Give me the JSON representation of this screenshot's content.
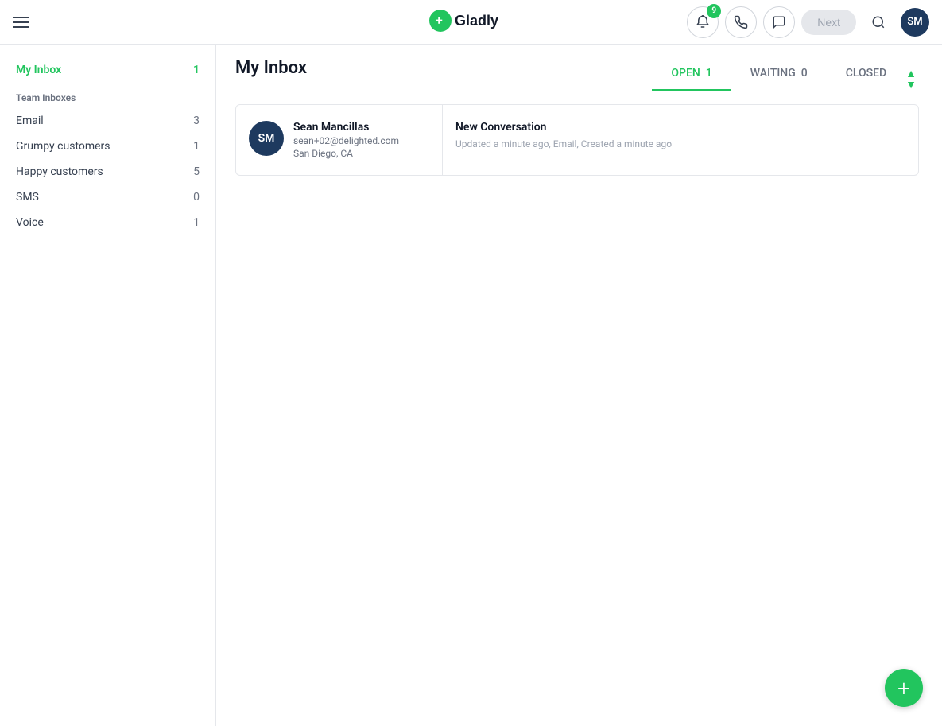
{
  "topnav": {
    "logo_text": "Gladly",
    "notification_badge": "9",
    "next_button_label": "Next",
    "avatar_initials": "SM"
  },
  "sidebar": {
    "my_inbox_label": "My Inbox",
    "my_inbox_count": "1",
    "team_inboxes_title": "Team Inboxes",
    "items": [
      {
        "label": "Email",
        "count": "3"
      },
      {
        "label": "Grumpy customers",
        "count": "1"
      },
      {
        "label": "Happy customers",
        "count": "5"
      },
      {
        "label": "SMS",
        "count": "0"
      },
      {
        "label": "Voice",
        "count": "1"
      }
    ]
  },
  "content": {
    "title": "My Inbox",
    "tabs": [
      {
        "label": "OPEN",
        "count": "1",
        "active": true
      },
      {
        "label": "WAITING",
        "count": "0",
        "active": false
      },
      {
        "label": "CLOSED",
        "count": "",
        "active": false
      }
    ],
    "conversations": [
      {
        "avatar_initials": "SM",
        "name": "Sean Mancillas",
        "email": "sean+02@delighted.com",
        "location": "San Diego, CA",
        "subject": "New Conversation",
        "meta": "Updated a minute ago, Email, Created a minute ago"
      }
    ]
  }
}
